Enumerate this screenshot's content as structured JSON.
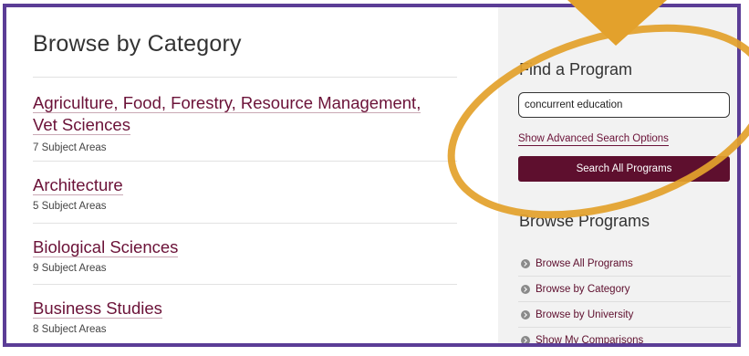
{
  "main": {
    "title": "Browse by Category",
    "categories": [
      {
        "name_line1": "Agriculture, Food, Forestry, Resource Management,",
        "name_line2": "Vet Sciences",
        "count": "7 Subject Areas"
      },
      {
        "name": "Architecture",
        "count": "5 Subject Areas"
      },
      {
        "name": "Biological Sciences",
        "count": "9 Subject Areas"
      },
      {
        "name": "Business Studies",
        "count": "8 Subject Areas"
      }
    ]
  },
  "sidebar": {
    "find_title": "Find a Program",
    "search": {
      "value": "concurrent education"
    },
    "advanced_link": "Show Advanced Search Options",
    "search_button": "Search All Programs",
    "browse_title": "Browse Programs",
    "browse_items": [
      "Browse All Programs",
      "Browse by Category",
      "Browse by University",
      "Show My Comparisons"
    ]
  },
  "colors": {
    "frame": "#5b3d96",
    "highlight": "#e3a12c",
    "accent": "#5e0f2e",
    "link": "#6b1238",
    "sidebar_bg": "#f2f2f2"
  },
  "icons": {
    "browse_bullet": "chevron-circle-icon",
    "annotation_arrow": "down-arrow-icon",
    "annotation_ellipse": "highlight-ellipse"
  }
}
